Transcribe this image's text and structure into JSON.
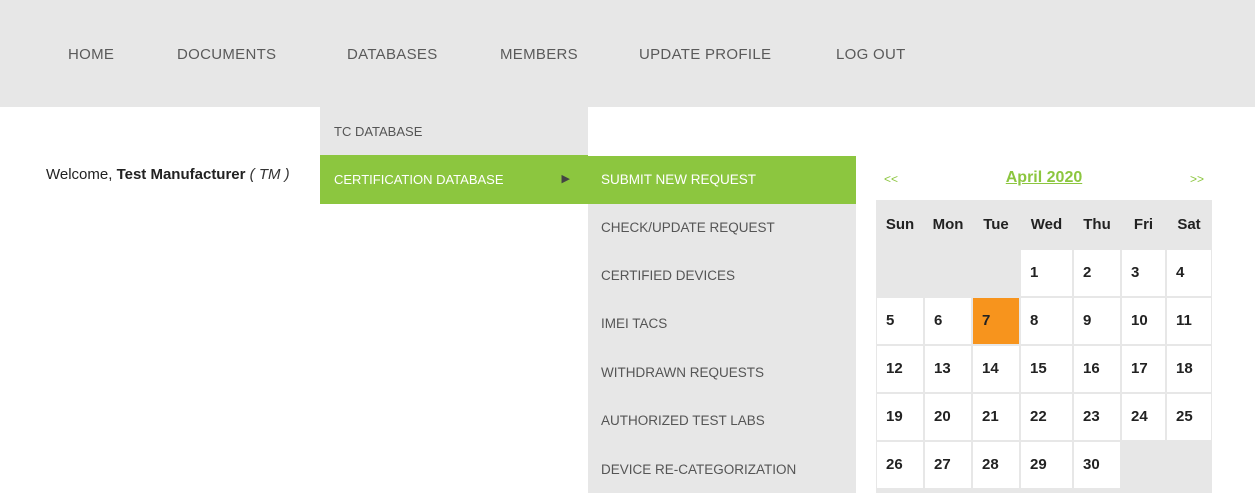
{
  "nav": {
    "items": [
      "HOME",
      "DOCUMENTS",
      "DATABASES",
      "MEMBERS",
      "UPDATE PROFILE",
      "LOG OUT"
    ]
  },
  "welcome": {
    "prefix": "Welcome, ",
    "name": "Test Manufacturer",
    "abbr": " ( TM )"
  },
  "databases_menu": {
    "items": [
      "TC DATABASE",
      "CERTIFICATION DATABASE"
    ],
    "submenu_arrow": "▶"
  },
  "certification_menu": {
    "items": [
      "SUBMIT NEW REQUEST",
      "CHECK/UPDATE REQUEST",
      "CERTIFIED DEVICES",
      "IMEI TACS",
      "WITHDRAWN REQUESTS",
      "AUTHORIZED TEST LABS",
      "DEVICE RE-CATEGORIZATION"
    ]
  },
  "calendar": {
    "prev": "<<",
    "next": ">>",
    "title": "April 2020",
    "weekdays": [
      "Sun",
      "Mon",
      "Tue",
      "Wed",
      "Thu",
      "Fri",
      "Sat"
    ],
    "days": [
      "1",
      "2",
      "3",
      "4",
      "5",
      "6",
      "7",
      "8",
      "9",
      "10",
      "11",
      "12",
      "13",
      "14",
      "15",
      "16",
      "17",
      "18",
      "19",
      "20",
      "21",
      "22",
      "23",
      "24",
      "25",
      "26",
      "27",
      "28",
      "29",
      "30"
    ],
    "today": "7"
  },
  "colors": {
    "accent_green": "#8cc63f",
    "today_orange": "#f7941d",
    "nav_bg": "#e7e7e7"
  }
}
